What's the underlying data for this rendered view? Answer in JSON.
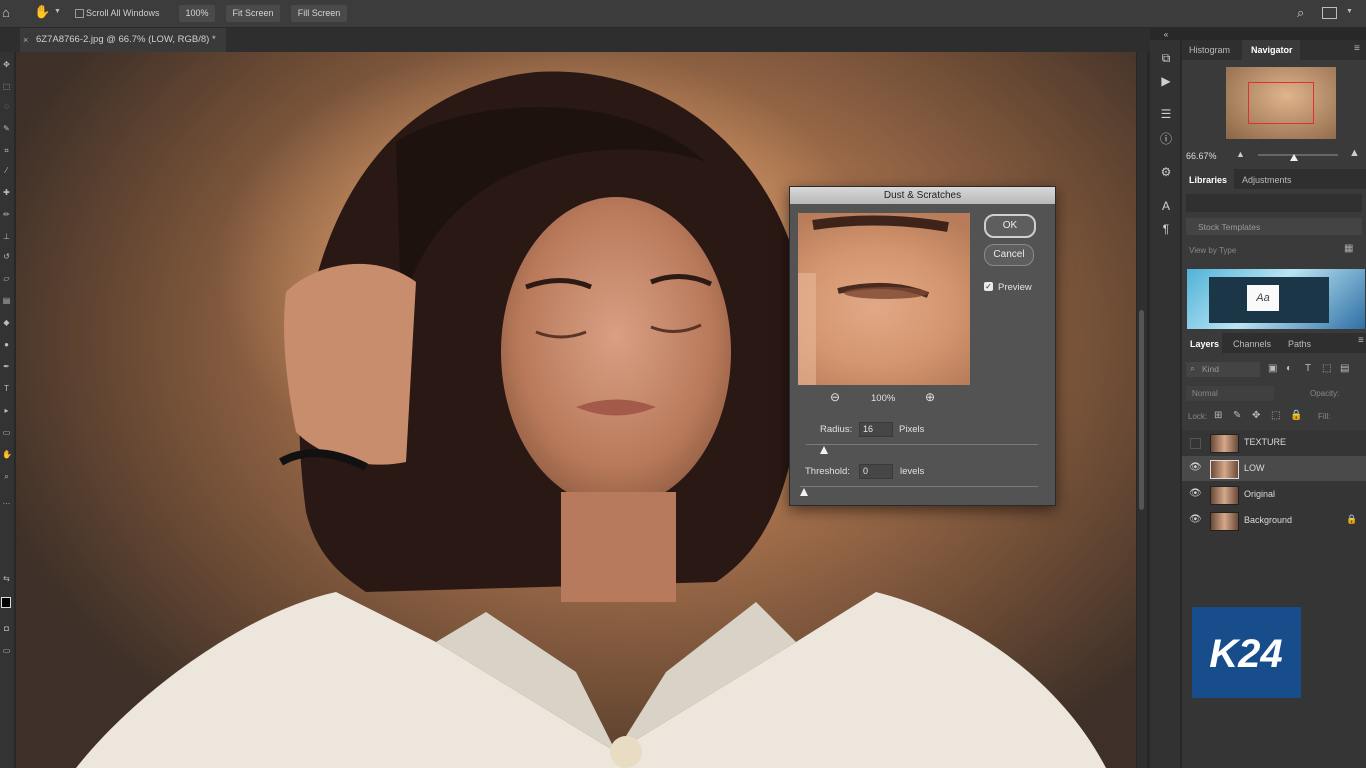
{
  "options_bar": {
    "scroll_all_windows": "Scroll All Windows",
    "zoom_100": "100%",
    "fit_screen": "Fit Screen",
    "fill_screen": "Fill Screen"
  },
  "document_tab": {
    "title": "6Z7A8766-2.jpg @ 66.7% (LOW, RGB/8) *"
  },
  "right_panel": {
    "tabs_top": [
      "Histogram",
      "Navigator"
    ],
    "navigator_zoom": "66.67%",
    "tabs_mid": [
      "Libraries",
      "Adjustments"
    ],
    "stock_templates": "Stock Templates",
    "view_by_type": "View by Type",
    "tabs_layers": [
      "Layers",
      "Channels",
      "Paths"
    ],
    "kind": "Kind",
    "blend_mode": "Normal",
    "opacity_label": "Opacity:",
    "lock_label": "Lock:",
    "fill_label": "Fill:",
    "layers": [
      {
        "name": "TEXTURE",
        "visible": false
      },
      {
        "name": "LOW",
        "visible": true
      },
      {
        "name": "Original",
        "visible": true
      },
      {
        "name": "Background",
        "visible": true,
        "locked": true
      }
    ]
  },
  "dialog": {
    "title": "Dust & Scratches",
    "ok": "OK",
    "cancel": "Cancel",
    "preview_label": "Preview",
    "preview_checked": true,
    "zoom": "100%",
    "radius_label": "Radius:",
    "radius_value": "16",
    "radius_unit": "Pixels",
    "threshold_label": "Threshold:",
    "threshold_value": "0",
    "threshold_unit": "levels"
  },
  "logo": {
    "text": "K24"
  }
}
